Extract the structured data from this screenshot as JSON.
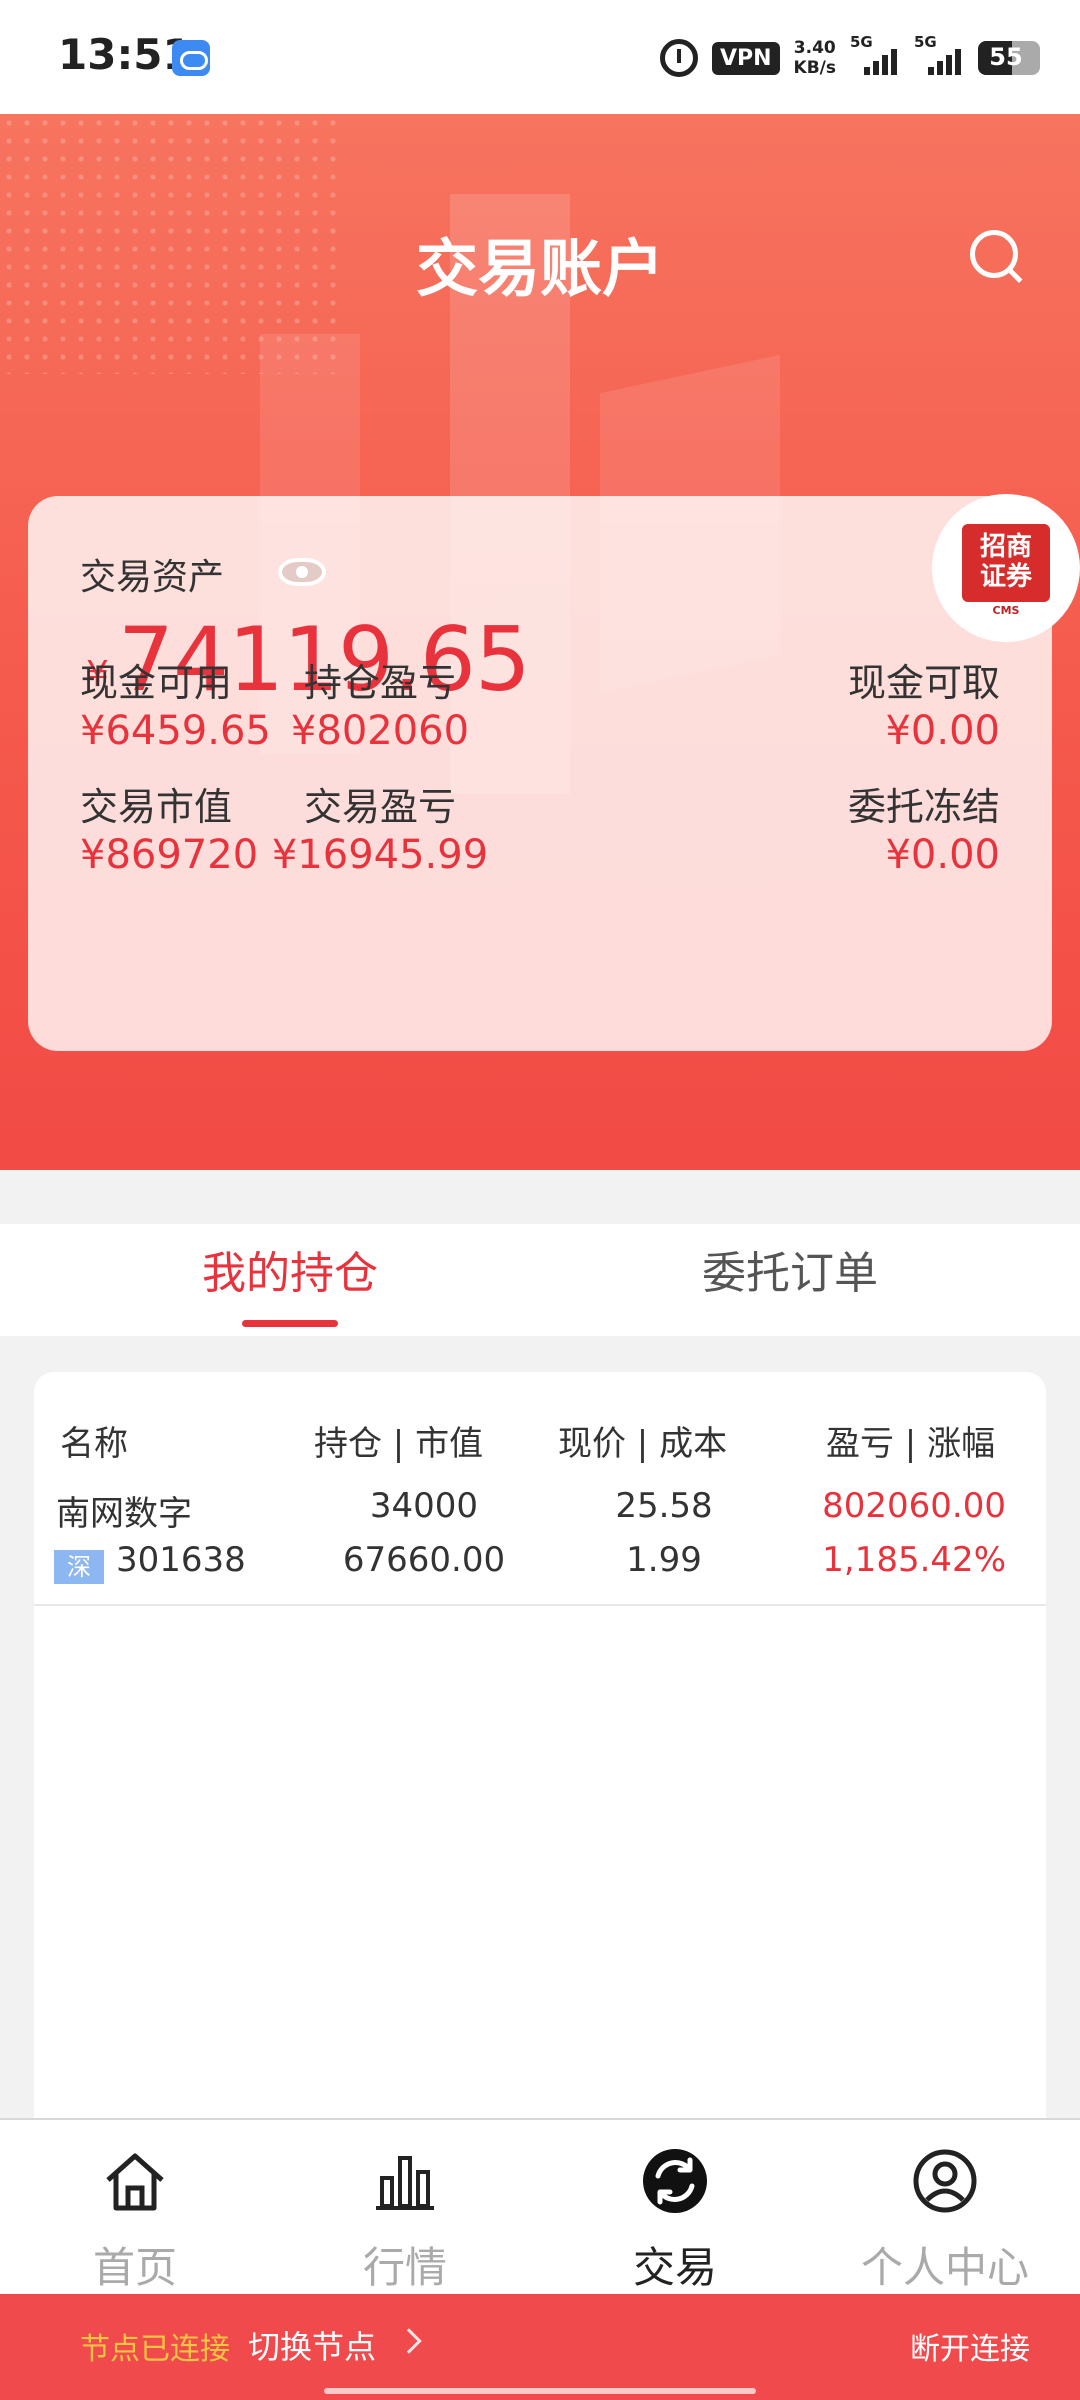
{
  "status_bar": {
    "time": "13:51",
    "vpn": "VPN",
    "speed_value": "3.40",
    "speed_unit": "KB/s",
    "sim1": "5G",
    "sim2": "5G",
    "battery": "55",
    "battery_level": 0.55
  },
  "header": {
    "title": "交易账户",
    "search_icon": "search-icon"
  },
  "asset_card": {
    "label": "交易资产",
    "currency": "¥",
    "total": "74119.65",
    "logo_text": "招商证券",
    "logo_sub": "CMS",
    "stats": [
      {
        "label": "现金可用",
        "value": "¥6459.65"
      },
      {
        "label": "持仓盈亏",
        "value": "¥802060"
      },
      {
        "label": "现金可取",
        "value": "¥0.00"
      },
      {
        "label": "交易市值",
        "value": "¥869720"
      },
      {
        "label": "交易盈亏",
        "value": "¥16945.99"
      },
      {
        "label": "委托冻结",
        "value": "¥0.00"
      }
    ]
  },
  "tabs": [
    {
      "label": "我的持仓",
      "active": true
    },
    {
      "label": "委托订单",
      "active": false
    }
  ],
  "holdings": {
    "headers": [
      "名称",
      "持仓 | 市值",
      "现价 | 成本",
      "盈亏 | 涨幅"
    ],
    "rows": [
      {
        "name": "南网数字",
        "market": "深",
        "code": "301638",
        "position": "34000",
        "market_value": "67660.00",
        "price": "25.58",
        "cost": "1.99",
        "pnl": "802060.00",
        "change": "1,185.42%"
      }
    ]
  },
  "bottom_nav": [
    {
      "label": "首页",
      "icon": "home-icon",
      "active": false
    },
    {
      "label": "行情",
      "icon": "bar-chart-icon",
      "active": false
    },
    {
      "label": "交易",
      "icon": "exchange-icon",
      "active": true
    },
    {
      "label": "个人中心",
      "icon": "user-icon",
      "active": false
    }
  ],
  "node_bar": {
    "status": "节点已连接",
    "switch_label": "切换节点",
    "disconnect_label": "断开连接"
  },
  "colors": {
    "accent": "#e8323c",
    "header_top": "#f7745f",
    "header_bottom": "#f24a45",
    "node_status": "#f5c542"
  }
}
